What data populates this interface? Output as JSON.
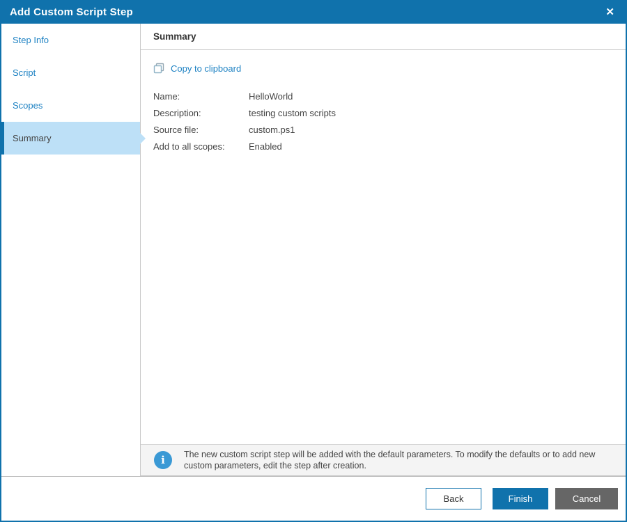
{
  "window": {
    "title": "Add Custom Script Step",
    "close_glyph": "✕"
  },
  "sidebar": {
    "items": [
      {
        "label": "Step Info",
        "active": false
      },
      {
        "label": "Script",
        "active": false
      },
      {
        "label": "Scopes",
        "active": false
      },
      {
        "label": "Summary",
        "active": true
      }
    ]
  },
  "content": {
    "heading": "Summary",
    "copy_link": "Copy to clipboard",
    "fields": [
      {
        "label": "Name:",
        "value": "HelloWorld"
      },
      {
        "label": "Description:",
        "value": "testing custom scripts"
      },
      {
        "label": "Source file:",
        "value": "custom.ps1"
      },
      {
        "label": "Add to all scopes:",
        "value": "Enabled"
      }
    ],
    "info_glyph": "i",
    "info_note": "The new custom script step will be added with the default parameters. To modify the defaults or to add new custom parameters, edit the step after creation."
  },
  "footer": {
    "back_label": "Back",
    "finish_label": "Finish",
    "cancel_label": "Cancel"
  },
  "colors": {
    "accent": "#1072ac",
    "link": "#1e82c3",
    "active_step_bg": "#bde0f7",
    "info_icon": "#3a99d5",
    "cancel_button": "#666666"
  }
}
